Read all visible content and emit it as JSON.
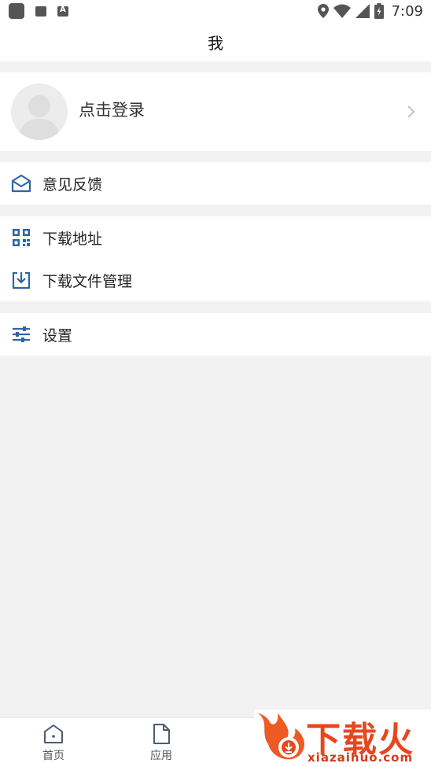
{
  "status_bar": {
    "time": "7:09"
  },
  "header": {
    "title": "我"
  },
  "profile": {
    "login_label": "点击登录"
  },
  "menu": {
    "feedback": "意见反馈",
    "download_address": "下载地址",
    "download_manager": "下载文件管理",
    "settings": "设置"
  },
  "tabs": {
    "home": "首页",
    "apps": "应用"
  },
  "watermark": {
    "brand": "下载火",
    "url": "xiazaihuo.com"
  },
  "colors": {
    "accent": "#2e64a8",
    "background": "#f2f2f2",
    "watermark": "#e8461d"
  }
}
